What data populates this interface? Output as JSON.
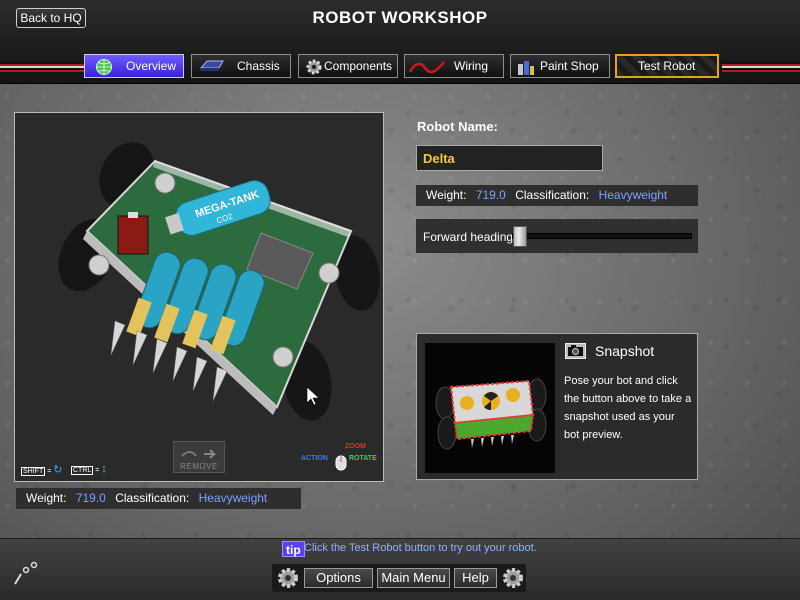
{
  "header": {
    "back_label": "Back to HQ",
    "title": "ROBOT WORKSHOP"
  },
  "tabs": [
    {
      "label": "Overview",
      "icon": "globe-icon",
      "active": true
    },
    {
      "label": "Chassis",
      "icon": "chassis-icon",
      "active": false
    },
    {
      "label": "Components",
      "icon": "gear-icon",
      "active": false
    },
    {
      "label": "Wiring",
      "icon": "wire-icon",
      "active": false
    },
    {
      "label": "Paint Shop",
      "icon": "paint-icon",
      "active": false
    },
    {
      "label": "Test Robot",
      "icon": "",
      "active": false
    }
  ],
  "viewport": {
    "shift_key": "SHIFT",
    "ctrl_key": "CTRL",
    "remove_label": "REMOVE",
    "zoom_label": "ZOOM",
    "action_label": "ACTION",
    "rotate_label": "ROTATE",
    "component_label": "MEGA-TANK",
    "component_sub": "CO2"
  },
  "stats": {
    "weight_label": "Weight:",
    "weight_value": "719.0",
    "classification_label": "Classification:",
    "classification_value": "Heavyweight"
  },
  "robot": {
    "name_label": "Robot Name:",
    "name_value": "Delta",
    "heading_label": "Forward heading:",
    "heading_value": 0.0
  },
  "snapshot": {
    "title": "Snapshot",
    "text": "Pose your bot and click the button above to take a snapshot used as your bot preview."
  },
  "footer": {
    "tip_badge": "tip",
    "tip_text": "Click the Test Robot button to try out your robot.",
    "options_label": "Options",
    "main_menu_label": "Main Menu",
    "help_label": "Help"
  },
  "colors": {
    "accent_blue": "#7ea0ff",
    "name_yellow": "#f7c83f",
    "active_tab": "#4a33e0",
    "test_robot_border": "#e2a21b"
  }
}
